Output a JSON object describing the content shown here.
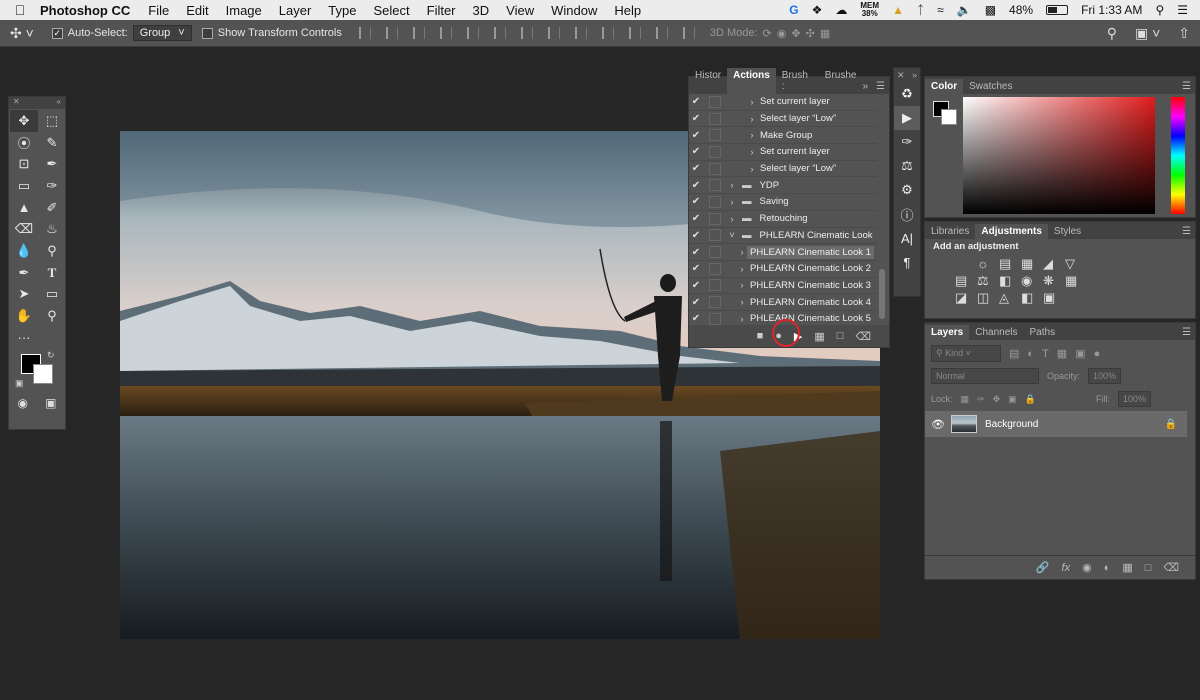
{
  "menubar": {
    "app_name": "Photoshop CC",
    "items": [
      "File",
      "Edit",
      "Image",
      "Layer",
      "Type",
      "Select",
      "Filter",
      "3D",
      "View",
      "Window",
      "Help"
    ],
    "mem_label": "MEM",
    "mem_value": "38%",
    "battery": "48%",
    "battery_level": 0.48,
    "clock": "Fri 1:33 AM"
  },
  "options_bar": {
    "auto_select_label": "Auto-Select:",
    "auto_select_checked": true,
    "auto_select_mode": "Group",
    "show_transform_label": "Show Transform Controls",
    "mode_3d_label": "3D Mode:"
  },
  "actions_panel": {
    "tabs": [
      "Histor",
      "Actions",
      "Brush :",
      "Brushe"
    ],
    "active_tab": "Actions",
    "rows": [
      {
        "label": "Set current layer",
        "indent": 3,
        "toggle": ">"
      },
      {
        "label": "Select layer “Low”",
        "indent": 3,
        "toggle": ">"
      },
      {
        "label": "Make Group",
        "indent": 3,
        "toggle": ">"
      },
      {
        "label": "Set current layer",
        "indent": 3,
        "toggle": ">"
      },
      {
        "label": "Select layer “Low”",
        "indent": 3,
        "toggle": ">"
      },
      {
        "label": "YDP",
        "indent": 1,
        "toggle": ">",
        "folder": true
      },
      {
        "label": "Saving",
        "indent": 1,
        "toggle": ">",
        "folder": true
      },
      {
        "label": "Retouching",
        "indent": 1,
        "toggle": ">",
        "folder": true
      },
      {
        "label": "PHLEARN Cinematic Look",
        "indent": 1,
        "toggle": "v",
        "folder": true
      },
      {
        "label": "PHLEARN Cinematic Look 1",
        "indent": 2,
        "toggle": ">",
        "selected": true
      },
      {
        "label": "PHLEARN Cinematic Look 2",
        "indent": 2,
        "toggle": ">"
      },
      {
        "label": "PHLEARN Cinematic Look 3",
        "indent": 2,
        "toggle": ">"
      },
      {
        "label": "PHLEARN Cinematic Look 4",
        "indent": 2,
        "toggle": ">"
      },
      {
        "label": "PHLEARN Cinematic Look 5",
        "indent": 2,
        "toggle": ">"
      }
    ]
  },
  "color_panel": {
    "tabs": [
      "Color",
      "Swatches"
    ],
    "active_tab": "Color"
  },
  "adjustments_panel": {
    "tabs": [
      "Libraries",
      "Adjustments",
      "Styles"
    ],
    "active_tab": "Adjustments",
    "heading": "Add an adjustment"
  },
  "layers_panel": {
    "tabs": [
      "Layers",
      "Channels",
      "Paths"
    ],
    "active_tab": "Layers",
    "filter_kind": "Kind",
    "blend_mode": "Normal",
    "opacity_label": "Opacity:",
    "opacity_value": "100%",
    "lock_label": "Lock:",
    "fill_label": "Fill:",
    "fill_value": "100%",
    "layers": [
      {
        "name": "Background",
        "locked": true,
        "visible": true
      }
    ]
  },
  "colors": {
    "accent_red": "#e0242a",
    "panel_bg": "#535353",
    "canvas_bg": "#262626"
  }
}
